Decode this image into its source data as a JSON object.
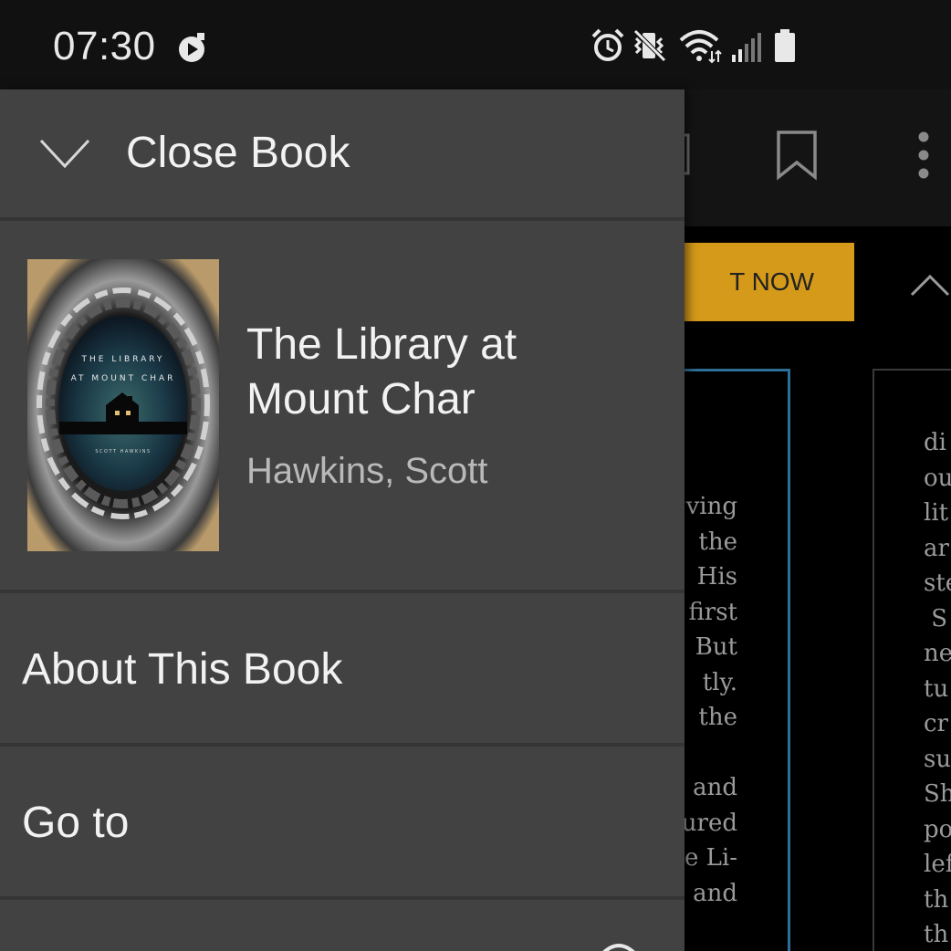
{
  "status_bar": {
    "time": "07:30",
    "icons": [
      "media-playing-icon",
      "alarm-icon",
      "vibrate-icon",
      "wifi-icon",
      "signal-icon",
      "battery-icon"
    ]
  },
  "reader": {
    "buy_banner_text": "T NOW",
    "left_page_lines": [
      "ving",
      "the",
      "His",
      "first",
      "But",
      "tly.",
      "the",
      "",
      "and",
      "ured",
      "e Li-",
      "and"
    ],
    "right_page_lines": [
      "di",
      "ou",
      "lit",
      "ar",
      "ste",
      " S",
      "ne",
      "tu",
      "cr",
      "su",
      "Sh",
      "po",
      "lef",
      "th",
      "th"
    ]
  },
  "drawer": {
    "close_label": "Close Book",
    "book": {
      "title": "The Library at Mount Char",
      "author": "Hawkins, Scott",
      "cover_title_line1": "THE LIBRARY",
      "cover_title_line2": "AT MOUNT CHAR",
      "cover_author": "SCOTT HAWKINS"
    },
    "menu_items": [
      {
        "label": "About This Book"
      },
      {
        "label": "Go to"
      }
    ]
  },
  "colors": {
    "drawer_bg": "#424242",
    "accent_banner": "#d69a1a",
    "page_border": "#2f6f97"
  }
}
